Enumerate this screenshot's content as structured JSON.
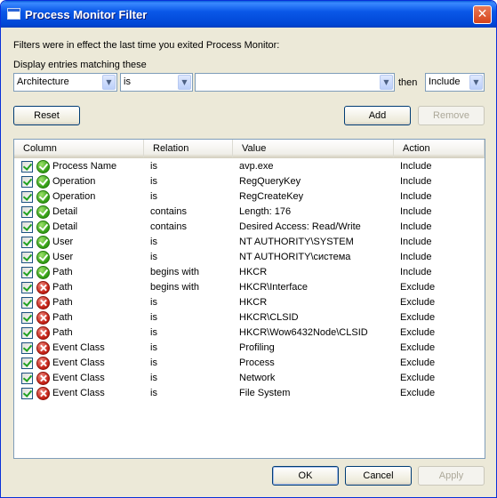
{
  "window": {
    "title": "Process Monitor Filter",
    "close_glyph": "✕"
  },
  "intro_text": "Filters were in effect the last time you exited Process Monitor:",
  "display_label": "Display entries matching these",
  "filter_bar": {
    "column_value": "Architecture",
    "relation_value": "is",
    "value_value": "",
    "then_label": "then",
    "action_value": "Include"
  },
  "buttons": {
    "reset": "Reset",
    "add": "Add",
    "remove": "Remove",
    "ok": "OK",
    "cancel": "Cancel",
    "apply": "Apply"
  },
  "table": {
    "headers": {
      "column": "Column",
      "relation": "Relation",
      "value": "Value",
      "action": "Action"
    },
    "rows": [
      {
        "column": "Process Name",
        "relation": "is",
        "value": "avp.exe",
        "action": "Include"
      },
      {
        "column": "Operation",
        "relation": "is",
        "value": "RegQueryKey",
        "action": "Include"
      },
      {
        "column": "Operation",
        "relation": "is",
        "value": "RegCreateKey",
        "action": "Include"
      },
      {
        "column": "Detail",
        "relation": "contains",
        "value": "Length: 176",
        "action": "Include"
      },
      {
        "column": "Detail",
        "relation": "contains",
        "value": "Desired Access: Read/Write",
        "action": "Include"
      },
      {
        "column": "User",
        "relation": "is",
        "value": "NT AUTHORITY\\SYSTEM",
        "action": "Include"
      },
      {
        "column": "User",
        "relation": "is",
        "value": "NT AUTHORITY\\система",
        "action": "Include"
      },
      {
        "column": "Path",
        "relation": "begins with",
        "value": "HKCR",
        "action": "Include"
      },
      {
        "column": "Path",
        "relation": "begins with",
        "value": "HKCR\\Interface",
        "action": "Exclude"
      },
      {
        "column": "Path",
        "relation": "is",
        "value": "HKCR",
        "action": "Exclude"
      },
      {
        "column": "Path",
        "relation": "is",
        "value": "HKCR\\CLSID",
        "action": "Exclude"
      },
      {
        "column": "Path",
        "relation": "is",
        "value": "HKCR\\Wow6432Node\\CLSID",
        "action": "Exclude"
      },
      {
        "column": "Event Class",
        "relation": "is",
        "value": "Profiling",
        "action": "Exclude"
      },
      {
        "column": "Event Class",
        "relation": "is",
        "value": "Process",
        "action": "Exclude"
      },
      {
        "column": "Event Class",
        "relation": "is",
        "value": "Network",
        "action": "Exclude"
      },
      {
        "column": "Event Class",
        "relation": "is",
        "value": "File System",
        "action": "Exclude"
      }
    ]
  }
}
